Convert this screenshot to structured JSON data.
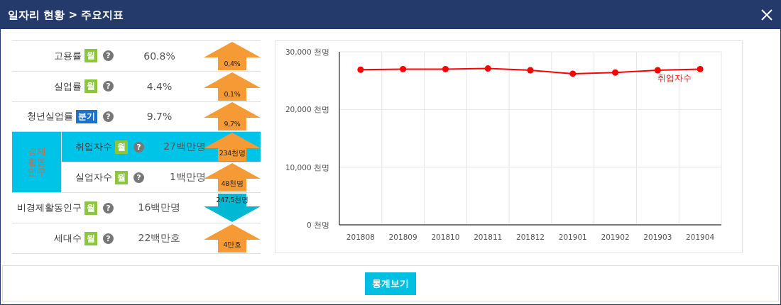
{
  "window": {
    "title": "일자리 현황 > 주요지표"
  },
  "indicators": [
    {
      "kind": "single",
      "label": "고용률",
      "badge": {
        "label": "월",
        "color": "#8cc63f"
      },
      "help": "?",
      "value": "60.8%",
      "change": {
        "rising": true,
        "label": "0,4%"
      }
    },
    {
      "kind": "single",
      "label": "실업률",
      "badge": {
        "label": "월",
        "color": "#8cc63f"
      },
      "help": "?",
      "value": "4.4%",
      "change": {
        "rising": true,
        "label": "0,1%"
      }
    },
    {
      "kind": "single",
      "label": "청년실업률",
      "badge": {
        "label": "분기",
        "color": "#1a73c8"
      },
      "help": "?",
      "value": "9.7%",
      "change": {
        "rising": true,
        "label": "9,7%"
      }
    },
    {
      "kind": "group",
      "label": "경제활동인구",
      "items": [
        {
          "label": "취업자수",
          "badge": {
            "label": "월",
            "color": "#8cc63f"
          },
          "help": "?",
          "value": "27백만명",
          "selected": true,
          "change": {
            "rising": true,
            "label": "234천명"
          }
        },
        {
          "label": "실업자수",
          "badge": {
            "label": "월",
            "color": "#8cc63f"
          },
          "help": "?",
          "value": "1백만명",
          "selected": false,
          "change": {
            "rising": true,
            "label": "48천명"
          }
        }
      ]
    },
    {
      "kind": "single",
      "label": "비경제활동인구",
      "badge": {
        "label": "월",
        "color": "#8cc63f"
      },
      "help": "?",
      "value": "16백만명",
      "change": {
        "rising": false,
        "label": "247,5천명"
      }
    },
    {
      "kind": "single",
      "label": "세대수",
      "badge": {
        "label": "월",
        "color": "#8cc63f"
      },
      "help": "?",
      "value": "22백만호",
      "change": {
        "rising": true,
        "label": "4만호"
      }
    }
  ],
  "chart_data": {
    "type": "line",
    "categories": [
      "201808",
      "201809",
      "201810",
      "201811",
      "201812",
      "201901",
      "201902",
      "201903",
      "201904"
    ],
    "series": [
      {
        "name": "취업자수",
        "color": "#ff0000",
        "marker": true,
        "values": [
          26900,
          27000,
          27000,
          27100,
          26800,
          26200,
          26400,
          26800,
          27000
        ]
      }
    ],
    "ylim": [
      0,
      30000
    ],
    "yticks": [
      {
        "value": 0,
        "label": "0 천명"
      },
      {
        "value": 10000,
        "label": "10,000 천명"
      },
      {
        "value": 20000,
        "label": "20,000 천명"
      },
      {
        "value": 30000,
        "label": "30,000 천명"
      }
    ]
  },
  "footer": {
    "button": "통계보기"
  }
}
